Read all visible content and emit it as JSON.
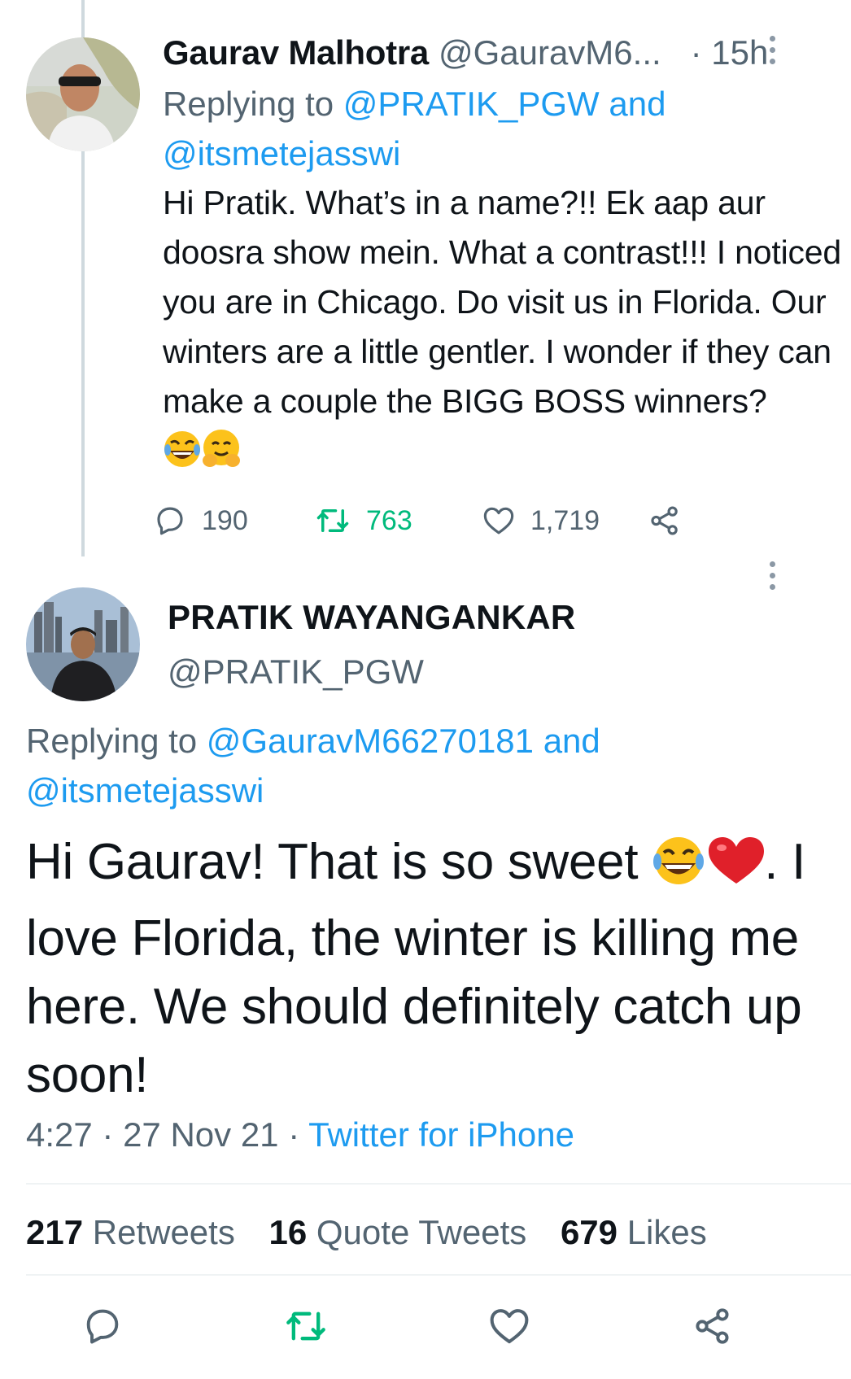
{
  "parent_tweet": {
    "name": "Gaurav Malhotra",
    "handle": "@GauravM6...",
    "time": "· 15h",
    "replying_prefix": "Replying to ",
    "replying_user1": "@PRATIK_PGW",
    "replying_and": " and",
    "replying_user2": "@itsmetejasswi",
    "text": "Hi Pratik. What’s in a name?!! Ek aap aur doosra show mein. What a contrast!!! I noticed you are in Chicago. Do visit us in Florida. Our winters are a little gentler. I wonder if they can make a couple the BIGG BOSS winners?",
    "emojis": "😂🤗",
    "replies": "190",
    "retweets": "763",
    "likes": "1,719"
  },
  "main_tweet": {
    "name": "PRATIK WAYANGANKAR",
    "handle": "@PRATIK_PGW",
    "replying_prefix": "Replying to ",
    "replying_user1": "@GauravM66270181",
    "replying_and": " and",
    "replying_user2": "@itsmetejasswi",
    "text_part1": "Hi Gaurav! That is so sweet ",
    "emojis": "😂❤️",
    "text_part2": ". I love Florida, the winter is killing me here. We should definitely catch up soon!",
    "time": "4:27",
    "date": "27 Nov 21",
    "source": "Twitter for iPhone",
    "meta_sep": " · ",
    "stats": {
      "retweets_count": "217",
      "retweets_label": "Retweets",
      "quotes_count": "16",
      "quotes_label": "Quote Tweets",
      "likes_count": "679",
      "likes_label": "Likes"
    }
  },
  "colors": {
    "link": "#1d9bf0",
    "muted": "#536471",
    "text": "#0f1419",
    "retweet_green": "#00ba7c"
  }
}
